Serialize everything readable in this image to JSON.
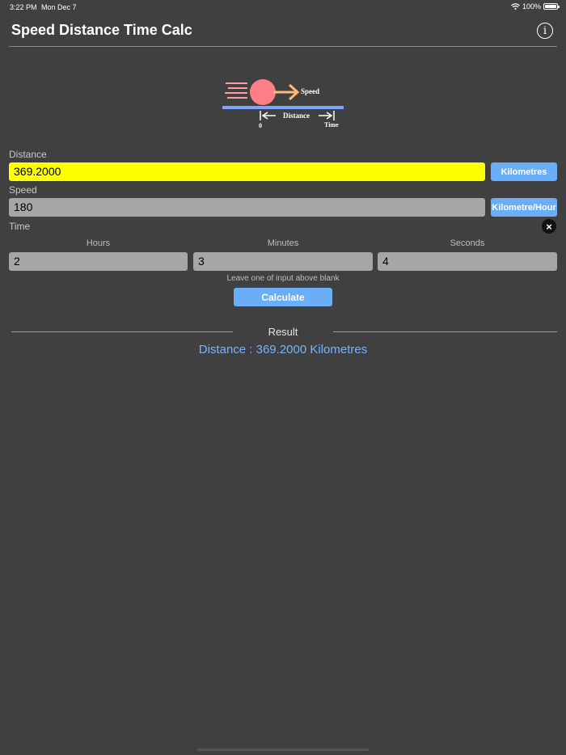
{
  "status_bar": {
    "time": "3:22 PM",
    "date": "Mon Dec 7",
    "battery": "100%"
  },
  "header": {
    "title": "Speed Distance Time Calc",
    "info_icon": "info-icon",
    "info_glyph": "i"
  },
  "diagram": {
    "speed": "Speed",
    "distance": "Distance",
    "zero": "0",
    "time": "Time",
    "ball_color": "#ff7f86",
    "arrow_color": "#ffb87a",
    "track_color": "#7fa4ff"
  },
  "distance": {
    "label": "Distance",
    "value": "369.2000",
    "unit": "Kilometres"
  },
  "speed": {
    "label": "Speed",
    "value": "180",
    "unit": "Kilometre/Hour"
  },
  "time": {
    "label": "Time",
    "clear_glyph": "×",
    "hours_label": "Hours",
    "hours_value": "2",
    "minutes_label": "Minutes",
    "minutes_value": "3",
    "seconds_label": "Seconds",
    "seconds_value": "4"
  },
  "hint": "Leave one of input above blank",
  "calculate_label": "Calculate",
  "result": {
    "label": "Result",
    "text": "Distance : 369.2000 Kilometres"
  },
  "colors": {
    "background": "#404040",
    "accent": "#6aaef7",
    "highlight": "#ffff00",
    "result_text": "#74b4ff"
  }
}
